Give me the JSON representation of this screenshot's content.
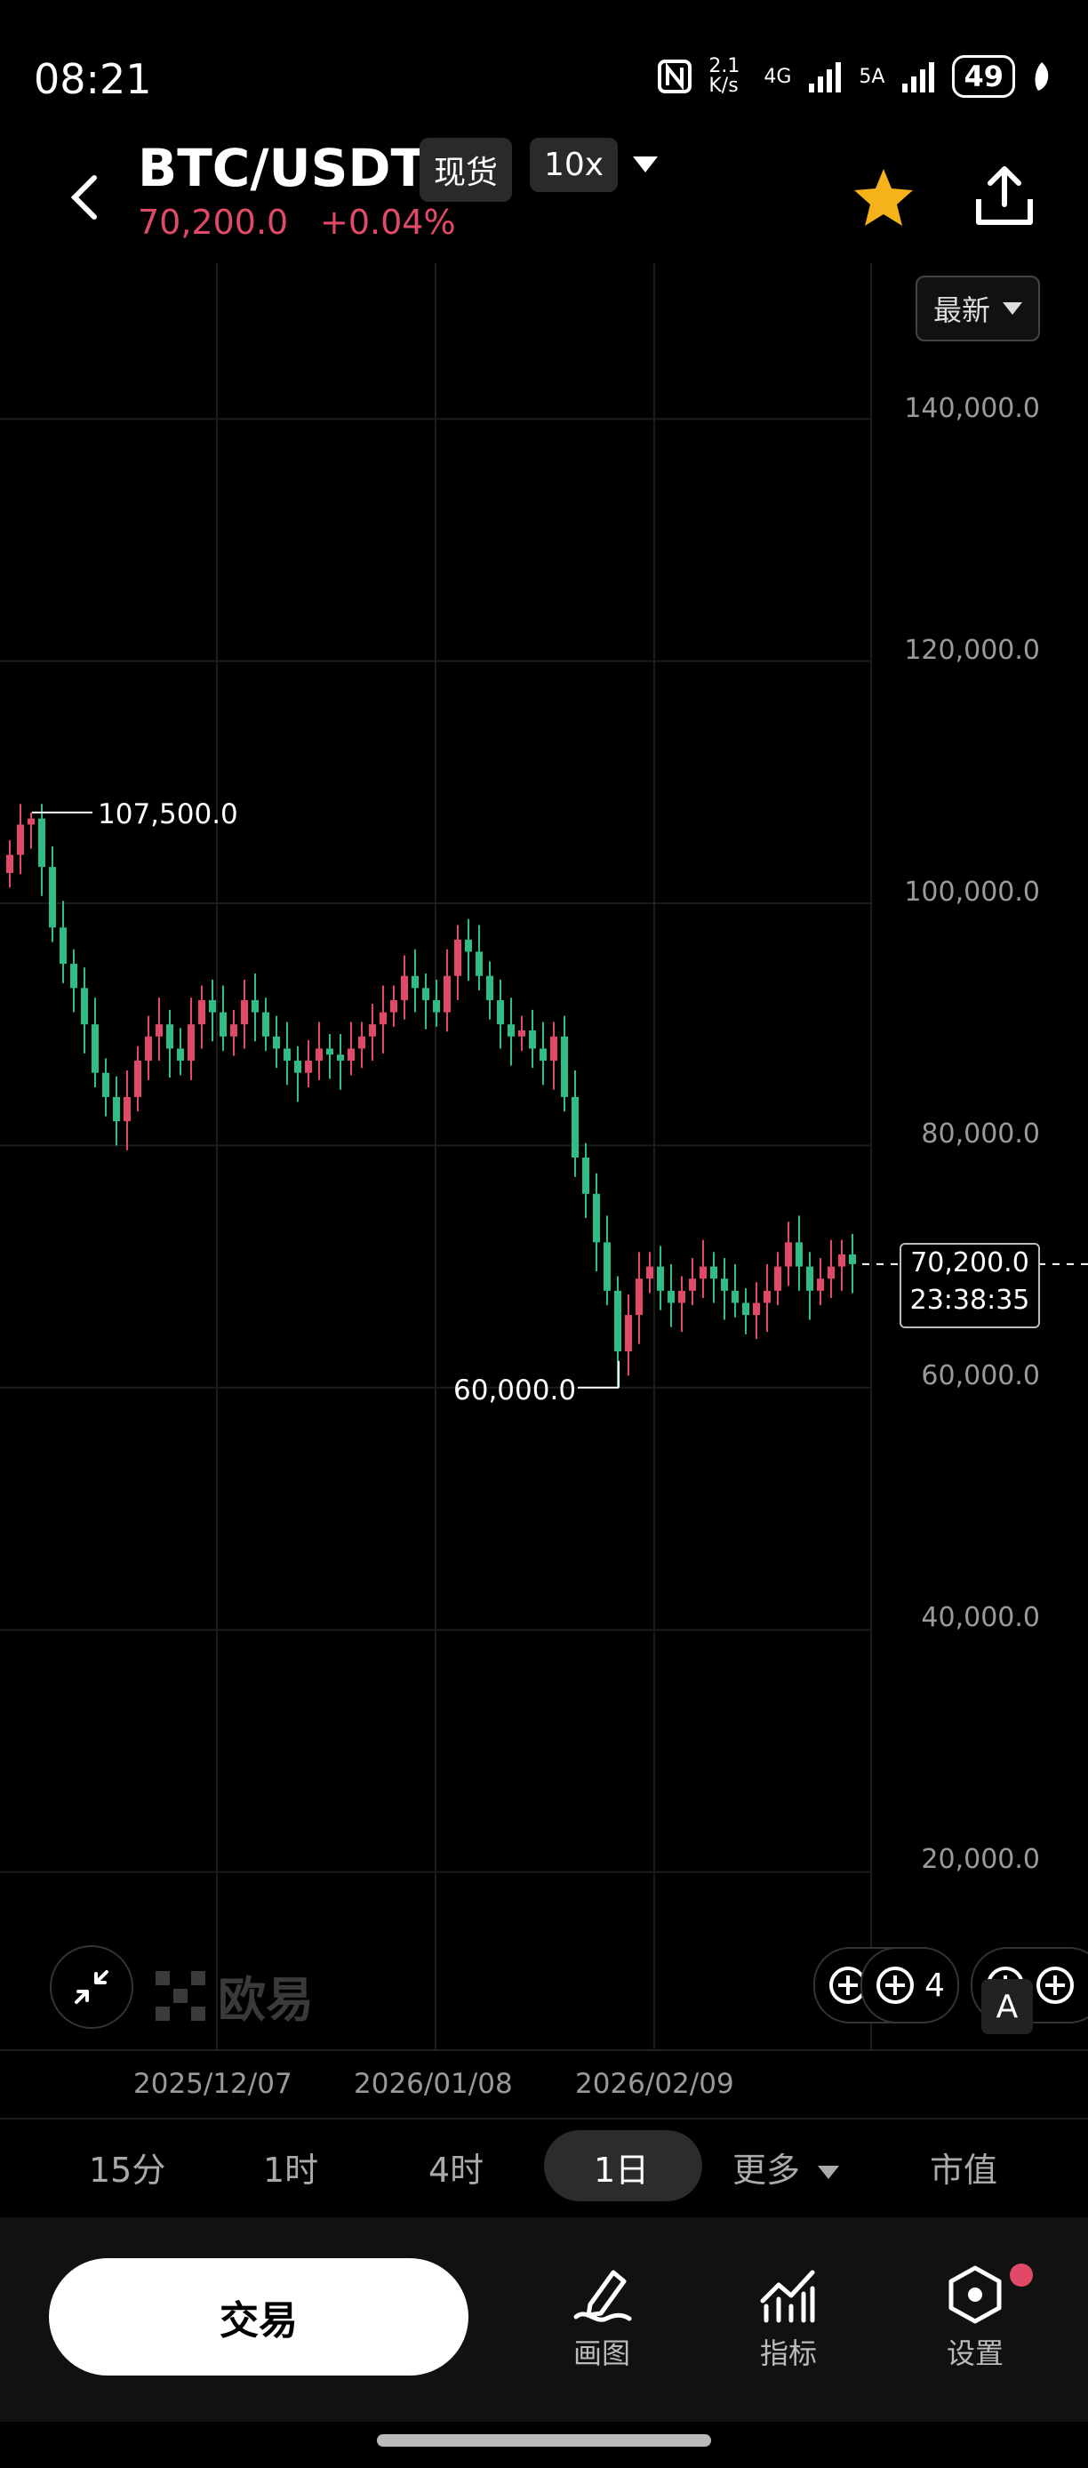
{
  "status_bar": {
    "time": "08:21",
    "net_speed": "2.1 K/s",
    "network_1": "4G",
    "network_2": "5A",
    "battery": "49"
  },
  "header": {
    "pair": "BTC/USDT",
    "market_tag": "现货",
    "leverage_tag": "10x",
    "last_price": "70,200.0",
    "change": "+0.04%"
  },
  "chart": {
    "latest_label": "最新",
    "y_ticks": [
      "140,000.0",
      "120,000.0",
      "100,000.0",
      "80,000.0",
      "60,000.0",
      "40,000.0",
      "20,000.0"
    ],
    "high_annotation": "107,500.0",
    "low_annotation": "60,000.0",
    "price_tag_price": "70,200.0",
    "price_tag_countdown": "23:38:35",
    "x_ticks": [
      "2025/12/07",
      "2026/01/08",
      "2026/02/09"
    ],
    "logo_text": "欧易",
    "indicator_count": "4",
    "a_label": "A",
    "colors": {
      "up": "#e04a67",
      "down": "#2ebd85"
    }
  },
  "chart_data": {
    "type": "candlestick",
    "ylim": [
      0,
      150000
    ],
    "y_ticks": [
      20000,
      40000,
      60000,
      80000,
      100000,
      120000,
      140000
    ],
    "x_ticks": [
      "2025/12/07",
      "2026/01/08",
      "2026/02/09"
    ],
    "high": 107500,
    "low": 60000,
    "last": 70200,
    "closes": [
      104000,
      106500,
      107000,
      103000,
      98000,
      95000,
      93000,
      90000,
      86000,
      84000,
      82000,
      84000,
      87000,
      89000,
      90000,
      88000,
      87000,
      90000,
      92000,
      91000,
      89000,
      90000,
      92000,
      91000,
      89000,
      88000,
      87000,
      86000,
      87000,
      88000,
      87500,
      87000,
      88000,
      89000,
      90000,
      91000,
      92000,
      94000,
      93000,
      92000,
      91000,
      94000,
      97000,
      96000,
      94000,
      92000,
      90000,
      89000,
      89500,
      88000,
      87000,
      89000,
      84000,
      79000,
      76000,
      72000,
      68000,
      63000,
      66000,
      69000,
      70000,
      68000,
      67000,
      68000,
      69000,
      70000,
      69000,
      68000,
      67000,
      66000,
      67000,
      68000,
      70000,
      72000,
      70000,
      68000,
      69000,
      70000,
      71000,
      70200
    ]
  },
  "timeframes": {
    "items": [
      "15分",
      "1时",
      "4时",
      "1日",
      "更多",
      "市值"
    ],
    "active": "1日"
  },
  "bottom_nav": {
    "trade": "交易",
    "draw": "画图",
    "indicators": "指标",
    "settings": "设置"
  }
}
